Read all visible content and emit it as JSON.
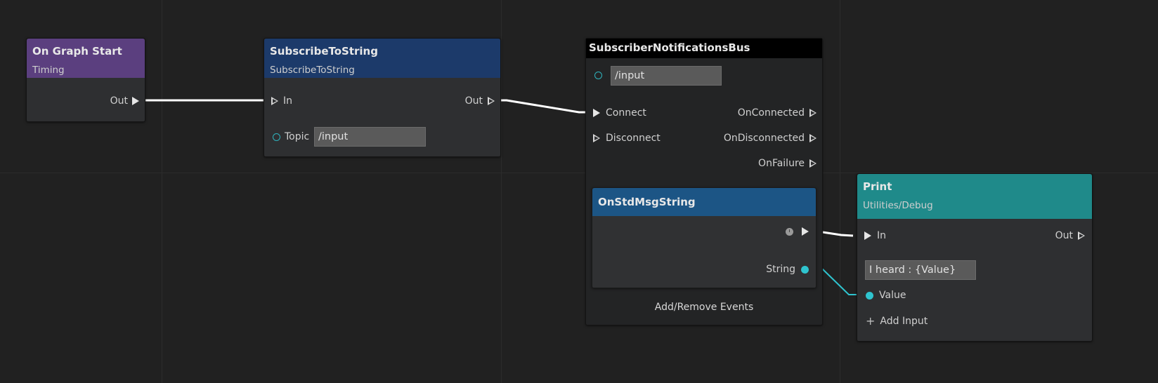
{
  "colors": {
    "canvas": "#212121",
    "timing_header": "#5b3f7f",
    "subscribe_header": "#1c3a6a",
    "bus_header": "#000000",
    "event_header": "#1c5585",
    "print_header": "#1f8a8a",
    "exec_wire": "#ffffff",
    "data_wire": "#2fc4cf"
  },
  "nodes": {
    "on_graph_start": {
      "title": "On Graph Start",
      "subtitle": "Timing",
      "out_label": "Out"
    },
    "subscribe_to_string": {
      "title": "SubscribeToString",
      "subtitle": "SubscribeToString",
      "in_label": "In",
      "out_label": "Out",
      "topic_label": "Topic",
      "topic_value": "/input"
    },
    "subscriber_bus": {
      "title": "SubscriberNotificationsBus",
      "address_value": "/input",
      "connect_label": "Connect",
      "disconnect_label": "Disconnect",
      "on_connected_label": "OnConnected",
      "on_disconnected_label": "OnDisconnected",
      "on_failure_label": "OnFailure",
      "event": {
        "title": "OnStdMsgString",
        "string_label": "String"
      },
      "add_remove_label": "Add/Remove Events"
    },
    "print": {
      "title": "Print",
      "subtitle": "Utilities/Debug",
      "in_label": "In",
      "out_label": "Out",
      "format_value": "I heard : {Value}",
      "value_label": "Value",
      "add_input_label": "Add Input",
      "add_input_icon": "plus-icon"
    }
  }
}
